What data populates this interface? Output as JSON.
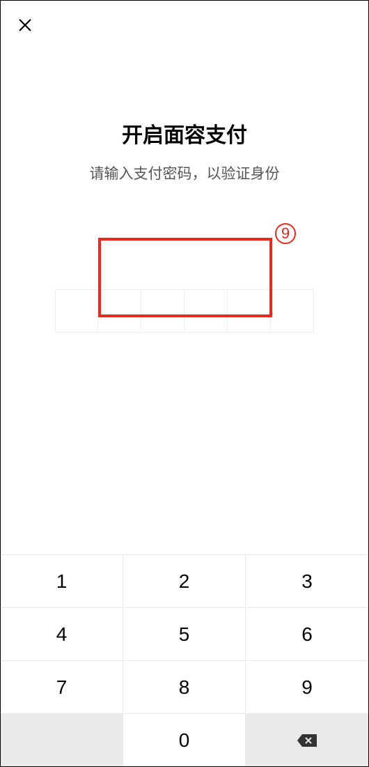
{
  "header": {
    "title": "开启面容支付",
    "subtitle": "请输入支付密码，以验证身份"
  },
  "annotation": {
    "badge": "9"
  },
  "keypad": {
    "keys": [
      "1",
      "2",
      "3",
      "4",
      "5",
      "6",
      "7",
      "8",
      "9",
      "",
      "0",
      ""
    ]
  }
}
